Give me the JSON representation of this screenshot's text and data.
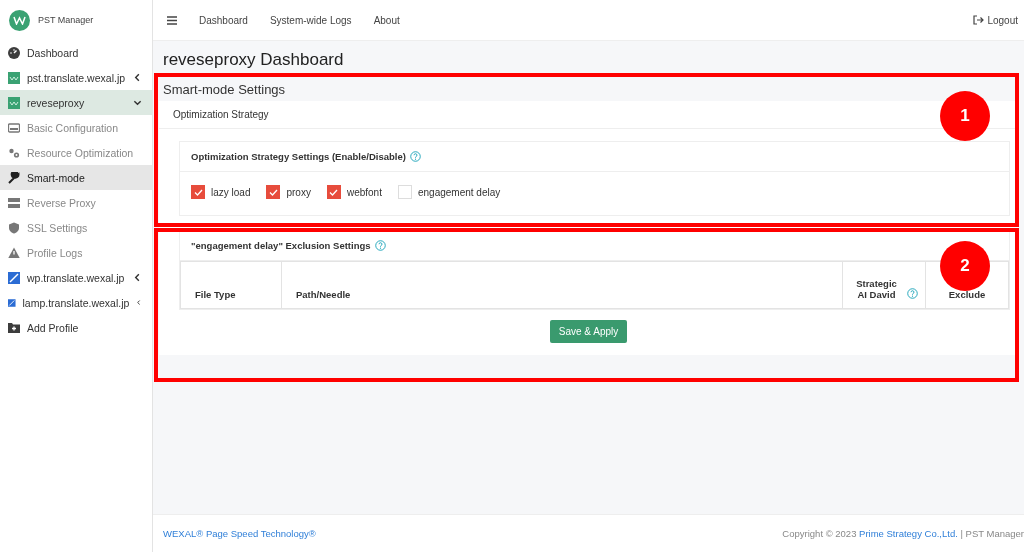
{
  "app": {
    "title": "PST Manager"
  },
  "sidebar": {
    "items": [
      {
        "label": "Dashboard",
        "selected": false
      },
      {
        "label": "pst.translate.wexal.jp",
        "selected": false,
        "expanded": false
      },
      {
        "label": "reveseproxy",
        "selected": true,
        "expanded": true,
        "children": [
          {
            "label": "Basic Configuration",
            "selected": false
          },
          {
            "label": "Resource Optimization",
            "selected": false
          },
          {
            "label": "Smart-mode",
            "selected": true
          },
          {
            "label": "Reverse Proxy",
            "selected": false
          },
          {
            "label": "SSL Settings",
            "selected": false
          },
          {
            "label": "Profile Logs",
            "selected": false
          }
        ]
      },
      {
        "label": "wp.translate.wexal.jp",
        "selected": false,
        "expanded": false
      },
      {
        "label": "lamp.translate.wexal.jp",
        "selected": false,
        "expanded": false
      },
      {
        "label": "Add Profile",
        "selected": false
      }
    ]
  },
  "topbar": {
    "links": [
      "Dashboard",
      "System-wide Logs",
      "About"
    ],
    "logout": "Logout"
  },
  "page_title": "reveseproxy Dashboard",
  "card": {
    "title": "Smart-mode Settings",
    "tab": "Optimization Strategy",
    "strategy": {
      "title": "Optimization Strategy Settings (Enable/Disable)",
      "options": [
        {
          "label": "lazy load",
          "checked": true
        },
        {
          "label": "proxy",
          "checked": true
        },
        {
          "label": "webfont",
          "checked": true
        },
        {
          "label": "engagement delay",
          "checked": false
        }
      ]
    },
    "exclusion": {
      "title": "\"engagement delay\" Exclusion Settings",
      "columns": [
        "File Type",
        "Path/Needle",
        "Strategic AI David",
        "Exclude"
      ]
    },
    "save_button": "Save & Apply"
  },
  "annotations": [
    "1",
    "2"
  ],
  "footer": {
    "brand": "WEXAL® Page Speed Technology®",
    "copyright": "Copyright © 2023",
    "company": "Prime Strategy Co.,Ltd.",
    "suffix": "| PST Manager"
  }
}
